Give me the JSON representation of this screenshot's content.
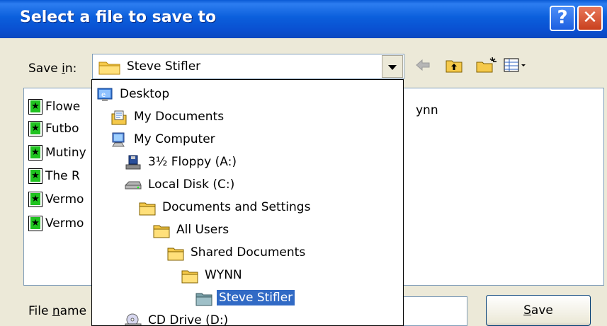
{
  "window": {
    "title": "Select a file to save to",
    "help_label": "?",
    "close_label": "✕"
  },
  "save_in": {
    "label_pre": "Save ",
    "label_accel": "i",
    "label_post": "n:",
    "value": "Steve Stifler"
  },
  "toolbar": {
    "icons": [
      "back-arrow-icon",
      "up-folder-icon",
      "new-folder-icon",
      "view-menu-icon"
    ]
  },
  "file_list": {
    "items": [
      {
        "name": "Flowe"
      },
      {
        "name": "Futbo"
      },
      {
        "name": "Mutiny"
      },
      {
        "name": "The R"
      },
      {
        "name": "Vermo"
      },
      {
        "name": "Vermo"
      }
    ],
    "partial_text": "ynn"
  },
  "location_dropdown": {
    "items": [
      {
        "label": "Desktop",
        "icon": "desktop-icon"
      },
      {
        "label": "My Documents",
        "icon": "my-documents-icon"
      },
      {
        "label": "My Computer",
        "icon": "my-computer-icon"
      },
      {
        "label": "3½ Floppy (A:)",
        "icon": "floppy-drive-icon"
      },
      {
        "label": "Local Disk (C:)",
        "icon": "hard-disk-icon"
      },
      {
        "label": "Documents and Settings",
        "icon": "folder-icon"
      },
      {
        "label": "All Users",
        "icon": "folder-icon"
      },
      {
        "label": "Shared Documents",
        "icon": "folder-icon"
      },
      {
        "label": "WYNN",
        "icon": "folder-icon"
      },
      {
        "label": "Steve Stifler",
        "icon": "open-folder-icon",
        "selected": true
      },
      {
        "label": "CD Drive (D:)",
        "icon": "cd-drive-icon"
      }
    ]
  },
  "file_name": {
    "label_pre": "File ",
    "label_accel": "n",
    "label_post": "ame",
    "value": ""
  },
  "save_button": {
    "accel": "S",
    "rest": "ave"
  },
  "colors": {
    "titlebar": "#0a5ad4",
    "selection": "#316ac5",
    "dialog_bg": "#ece9d8"
  }
}
